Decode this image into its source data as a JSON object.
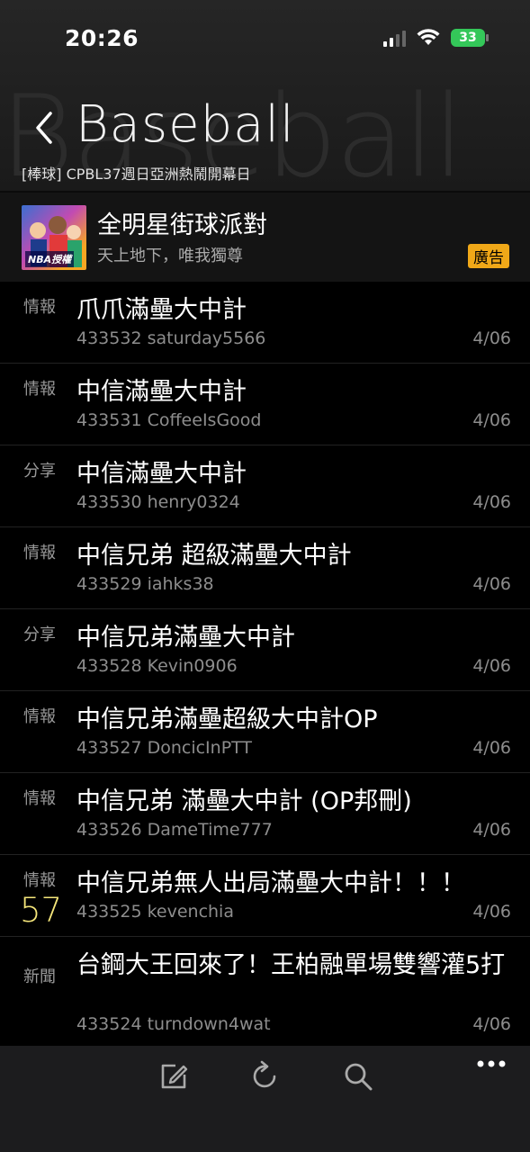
{
  "status": {
    "time": "20:26",
    "battery": "33"
  },
  "header": {
    "title": "Baseball",
    "subtitle": "[棒球] CPBL37週日亞洲熱鬧開幕日"
  },
  "ad": {
    "title": "全明星街球派對",
    "subtitle": "天上地下，唯我獨尊",
    "tag": "廣告",
    "thumb_badge": "NBA授權"
  },
  "posts": [
    {
      "category": "情報",
      "title": "爪爪滿壘大中計",
      "id": "433532",
      "author": "saturday5566",
      "date": "4/06",
      "push": ""
    },
    {
      "category": "情報",
      "title": "中信滿壘大中計",
      "id": "433531",
      "author": "CoffeeIsGood",
      "date": "4/06",
      "push": ""
    },
    {
      "category": "分享",
      "title": "中信滿壘大中計",
      "id": "433530",
      "author": "henry0324",
      "date": "4/06",
      "push": ""
    },
    {
      "category": "情報",
      "title": "中信兄弟 超級滿壘大中計",
      "id": "433529",
      "author": "iahks38",
      "date": "4/06",
      "push": ""
    },
    {
      "category": "分享",
      "title": "中信兄弟滿壘大中計",
      "id": "433528",
      "author": "Kevin0906",
      "date": "4/06",
      "push": ""
    },
    {
      "category": "情報",
      "title": "中信兄弟滿壘超級大中計OP",
      "id": "433527",
      "author": "DoncicInPTT",
      "date": "4/06",
      "push": ""
    },
    {
      "category": "情報",
      "title": "中信兄弟 滿壘大中計 (OP邦刪)",
      "id": "433526",
      "author": "DameTime777",
      "date": "4/06",
      "push": ""
    },
    {
      "category": "情報",
      "title": "中信兄弟無人出局滿壘大中計！！！",
      "id": "433525",
      "author": "kevenchia",
      "date": "4/06",
      "push": "57"
    },
    {
      "category": "新聞",
      "title": "台鋼大王回來了！王柏融單場雙響灌5打",
      "id": "433524",
      "author": "turndown4wat",
      "date": "4/06",
      "push": ""
    }
  ],
  "toolbar": {
    "icons": [
      "compose-icon",
      "refresh-icon",
      "search-icon",
      "more-icon"
    ]
  }
}
